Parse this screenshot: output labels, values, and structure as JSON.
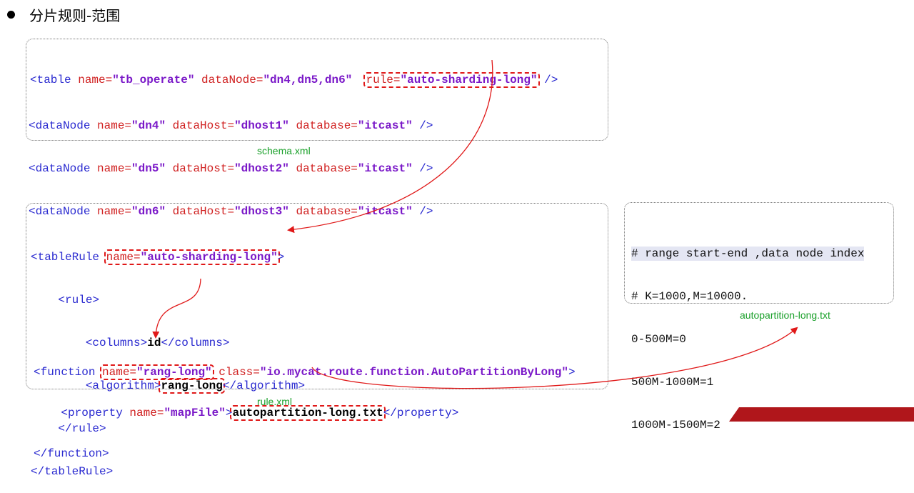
{
  "title": "分片规则-范围",
  "schema": {
    "table_line": {
      "open": "<table",
      "name_attr": " name=",
      "name_val": "\"tb_operate\"",
      "dn_attr": " dataNode=",
      "dn_val": "\"dn4,dn5,dn6\"",
      "rule_attr": "rule=",
      "rule_val": "\"auto-sharding-long\"",
      "close": " />"
    },
    "datanodes": [
      {
        "name": "\"dn4\"",
        "host": "\"dhost1\"",
        "db": "\"itcast\""
      },
      {
        "name": "\"dn5\"",
        "host": "\"dhost2\"",
        "db": "\"itcast\""
      },
      {
        "name": "\"dn6\"",
        "host": "\"dhost3\"",
        "db": "\"itcast\""
      }
    ],
    "dn_open": "<dataNode",
    "dn_name_attr": " name=",
    "dn_host_attr": " dataHost=",
    "dn_db_attr": " database=",
    "dn_close": " />",
    "caption": "schema.xml"
  },
  "rule": {
    "tablerule_open": "<tableRule ",
    "tablerule_name_attr": "name=",
    "tablerule_name_val": "\"auto-sharding-long\"",
    "tablerule_open_end": ">",
    "rule_open": "<rule>",
    "columns_open": "<columns>",
    "columns_val": "id",
    "columns_close": "</columns>",
    "algorithm_open": "<algorithm>",
    "algorithm_val": "rang-long",
    "algorithm_close": "</algorithm>",
    "rule_close": "</rule>",
    "tablerule_close": "</tableRule>",
    "function_open": "<function ",
    "function_name_attr": "name=",
    "function_name_val": "\"rang-long\"",
    "function_class_attr": " class=",
    "function_class_val": "\"io.mycat.route.function.AutoPartitionByLong\"",
    "function_open_end": ">",
    "property_open": "<property ",
    "property_name_attr": "name=",
    "property_name_val": "\"mapFile\"",
    "property_open_end": ">",
    "property_val": "autopartition-long.txt",
    "property_close": "</property>",
    "function_close": "</function>",
    "caption": "rule.xml"
  },
  "mapfile": {
    "lines": [
      "# range start-end ,data node index",
      "# K=1000,M=10000.",
      "0-500M=0",
      "500M-1000M=1",
      "1000M-1500M=2"
    ],
    "caption": "autopartition-long.txt"
  },
  "colors": {
    "tag": "#2a2ad0",
    "attr": "#d02020",
    "value": "#7a18c8",
    "highlight": "#e01818",
    "caption": "#1aa02a",
    "arrow": "#e01818"
  }
}
